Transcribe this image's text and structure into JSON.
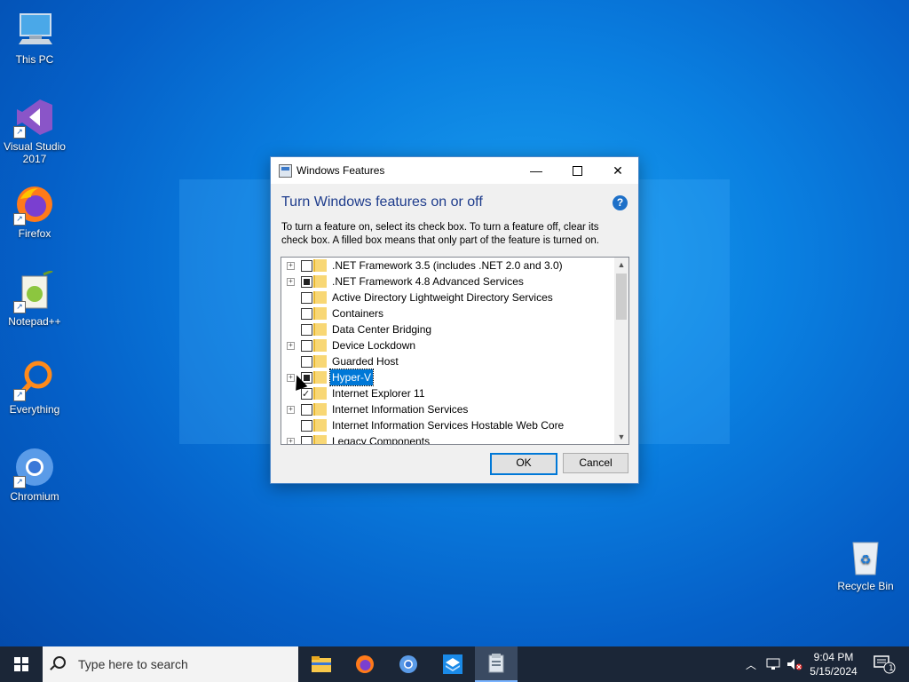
{
  "desktop": {
    "icons": [
      {
        "label": "This PC",
        "icon": "this-pc-icon"
      },
      {
        "label": "Visual Studio 2017",
        "icon": "visual-studio-icon"
      },
      {
        "label": "Firefox",
        "icon": "firefox-icon"
      },
      {
        "label": "Notepad++",
        "icon": "notepad-plus-plus-icon"
      },
      {
        "label": "Everything",
        "icon": "everything-search-icon"
      },
      {
        "label": "Chromium",
        "icon": "chromium-icon"
      },
      {
        "label": "Recycle Bin",
        "icon": "recycle-bin-icon"
      }
    ]
  },
  "dialog": {
    "title": "Windows Features",
    "heading": "Turn Windows features on or off",
    "description": "To turn a feature on, select its check box. To turn a feature off, clear its check box. A filled box means that only part of the feature is turned on.",
    "help_glyph": "?",
    "features": [
      {
        "label": ".NET Framework 3.5 (includes .NET 2.0 and 3.0)",
        "expandable": true,
        "state": "unchecked"
      },
      {
        "label": ".NET Framework 4.8 Advanced Services",
        "expandable": true,
        "state": "partial"
      },
      {
        "label": "Active Directory Lightweight Directory Services",
        "expandable": false,
        "state": "unchecked"
      },
      {
        "label": "Containers",
        "expandable": false,
        "state": "unchecked"
      },
      {
        "label": "Data Center Bridging",
        "expandable": false,
        "state": "unchecked"
      },
      {
        "label": "Device Lockdown",
        "expandable": true,
        "state": "unchecked"
      },
      {
        "label": "Guarded Host",
        "expandable": false,
        "state": "unchecked"
      },
      {
        "label": "Hyper-V",
        "expandable": true,
        "state": "partial",
        "selected": true
      },
      {
        "label": "Internet Explorer 11",
        "expandable": false,
        "state": "checked"
      },
      {
        "label": "Internet Information Services",
        "expandable": true,
        "state": "unchecked"
      },
      {
        "label": "Internet Information Services Hostable Web Core",
        "expandable": false,
        "state": "unchecked"
      },
      {
        "label": "Legacy Components",
        "expandable": true,
        "state": "unchecked"
      }
    ],
    "ok_label": "OK",
    "cancel_label": "Cancel"
  },
  "taskbar": {
    "search_placeholder": "Type here to search",
    "pinned": [
      {
        "name": "file-explorer",
        "icon": "folder-icon"
      },
      {
        "name": "firefox",
        "icon": "firefox-icon"
      },
      {
        "name": "chromium",
        "icon": "chromium-icon"
      },
      {
        "name": "unknown-app",
        "icon": "app-box-icon"
      },
      {
        "name": "windows-features",
        "icon": "windows-features-icon",
        "active": true
      }
    ],
    "time": "9:04 PM",
    "date": "5/15/2024",
    "notification_count": "1"
  },
  "colors": {
    "accent": "#0078d7",
    "heading": "#1e3c8c",
    "taskbar": "#1b2637"
  }
}
